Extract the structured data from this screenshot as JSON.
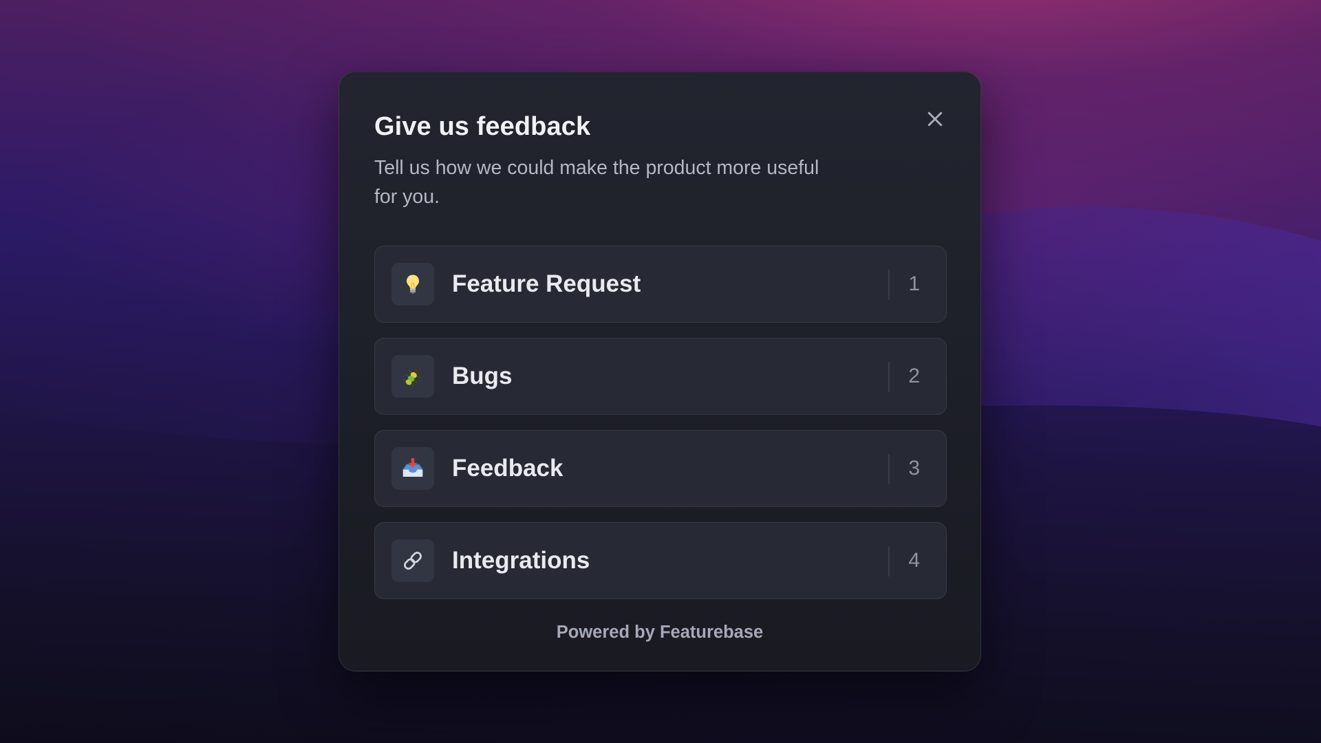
{
  "modal": {
    "title": "Give us feedback",
    "subtitle": "Tell us how we could make the product more useful for you.",
    "close_icon": "close-icon",
    "options": [
      {
        "label": "Feature Request",
        "shortcut": "1",
        "icon": "lightbulb-icon"
      },
      {
        "label": "Bugs",
        "shortcut": "2",
        "icon": "bug-icon"
      },
      {
        "label": "Feedback",
        "shortcut": "3",
        "icon": "inbox-tray-icon"
      },
      {
        "label": "Integrations",
        "shortcut": "4",
        "icon": "link-icon"
      }
    ],
    "footer": "Powered by Featurebase"
  },
  "colors": {
    "modal_background": "#1d1f28",
    "option_background": "#272a35",
    "title_text": "#f1f2f6",
    "muted_text": "#b4b8c5",
    "background_top": "#53205f",
    "background_bottom": "#0e0c1c"
  }
}
